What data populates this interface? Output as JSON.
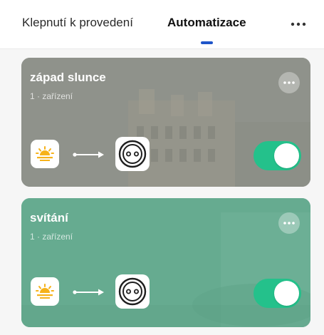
{
  "header": {
    "tabs": [
      {
        "label": "Klepnutí k provedení",
        "active": false
      },
      {
        "label": "Automatizace",
        "active": true
      }
    ],
    "more_icon": "more-horizontal-icon"
  },
  "cards": [
    {
      "title": "západ slunce",
      "subtitle": "1 · zařízení",
      "trigger_icon": "sunset-icon",
      "device_icon": "socket-icon",
      "enabled": true,
      "background_color": "#8f928b"
    },
    {
      "title": "svítání",
      "subtitle": "1 · zařízení",
      "trigger_icon": "sunrise-icon",
      "device_icon": "socket-icon",
      "enabled": true,
      "background_color": "#66ab90"
    }
  ],
  "colors": {
    "accent": "#1f55c9",
    "toggle_on": "#24c18b",
    "sun": "#f6b21a"
  }
}
